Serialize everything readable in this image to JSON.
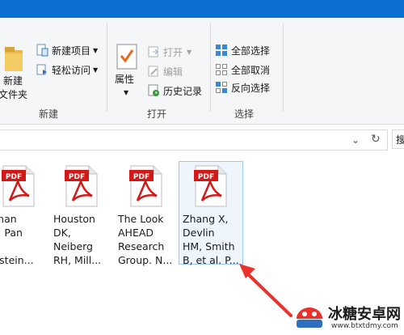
{
  "ribbon": {
    "new_group": {
      "new_folder_line1": "新建",
      "new_folder_line2": "文件夹",
      "new_item": "新建项目",
      "easy_access": "轻松访问",
      "label": "新建"
    },
    "open_group": {
      "properties": "属性",
      "open": "打开",
      "edit": "编辑",
      "history": "历史记录",
      "label": "打开"
    },
    "select_group": {
      "select_all": "全部选择",
      "select_none": "全部取消",
      "invert": "反向选择",
      "label": "选择"
    }
  },
  "address": {
    "search_stub": "搜"
  },
  "files": [
    {
      "badge": "PDF",
      "name": "rman\nH, Pan\n\nelstein..."
    },
    {
      "badge": "PDF",
      "name": "Houston\nDK,\nNeiberg\nRH, Mill..."
    },
    {
      "badge": "PDF",
      "name": "The Look\nAHEAD\nResearch\nGroup. N..."
    },
    {
      "badge": "PDF",
      "name": "Zhang X,\nDevlin\nHM, Smith\nB, et al. P..."
    }
  ],
  "watermark": {
    "title": "冰糖安卓网",
    "url": "www.btxtdmy.com"
  },
  "colors": {
    "title_bar": "#0a6fd1",
    "pdf_red": "#d11a17",
    "arrow_red": "#e8322b",
    "selection": "#eef5fd"
  }
}
